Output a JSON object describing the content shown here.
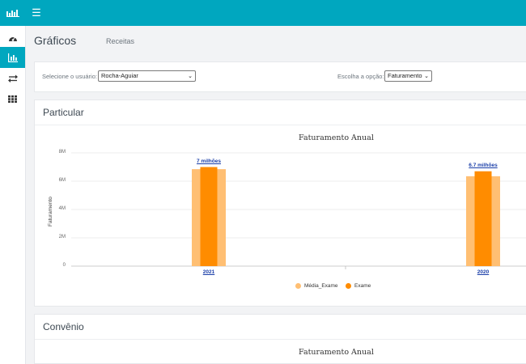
{
  "colors": {
    "accent": "#00a7bf",
    "exame": "#ff8c00",
    "media_exame": "#ffbf73"
  },
  "header": {
    "menu_icon": "☰"
  },
  "sidebar": {
    "icons": [
      "dashboard-icon",
      "bar-chart-icon",
      "transfer-icon",
      "grid-icon"
    ],
    "active_index": 1
  },
  "page": {
    "title": "Gráficos",
    "subtitle": "Receitas"
  },
  "filters": {
    "user_label": "Selecione o usuário:",
    "user_value": "Rocha-Aguiar",
    "option_label": "Escolha a opção:",
    "option_value": "Faturamento"
  },
  "cards": [
    {
      "title": "Particular"
    },
    {
      "title": "Convênio"
    }
  ],
  "chart_data": [
    {
      "type": "bar",
      "title": "Faturamento Anual",
      "ylabel": "Faturamento",
      "ylim": [
        0,
        8000000
      ],
      "yticks": [
        "0",
        "2M",
        "4M",
        "6M",
        "8M"
      ],
      "categories": [
        "2021",
        "2020"
      ],
      "series": [
        {
          "name": "Média_Exame",
          "values": [
            6850000,
            6350000
          ]
        },
        {
          "name": "Exame",
          "values": [
            7000000,
            6700000
          ]
        }
      ],
      "data_labels": [
        "7 milhões",
        "6.7 milhões"
      ],
      "legend": "bottom-center",
      "grid": true
    },
    {
      "type": "bar",
      "title": "Faturamento Anual"
    }
  ]
}
